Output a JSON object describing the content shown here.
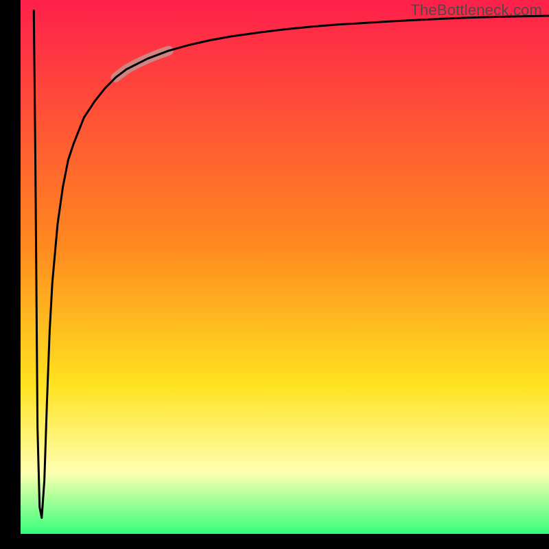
{
  "watermark": "TheBottleneck.com",
  "chart_data": {
    "type": "line",
    "title": "",
    "xlabel": "",
    "ylabel": "",
    "xlim": [
      0,
      100
    ],
    "ylim": [
      0,
      100
    ],
    "background_gradient": {
      "stops": [
        {
          "offset": 0.0,
          "color": "#ff1f4b"
        },
        {
          "offset": 0.45,
          "color": "#ff8a1f"
        },
        {
          "offset": 0.7,
          "color": "#ffe21f"
        },
        {
          "offset": 0.86,
          "color": "#ffffb0"
        },
        {
          "offset": 0.96,
          "color": "#4cff82"
        },
        {
          "offset": 1.0,
          "color": "#00e46b"
        }
      ]
    },
    "axis_band_color": "#000000",
    "axis_band_thickness_px_left": 30,
    "axis_band_thickness_px_bottom": 22,
    "series": [
      {
        "name": "bottleneck-curve",
        "color": "#000000",
        "stroke_width": 3,
        "x": [
          2.5,
          2.8,
          3.0,
          3.2,
          3.6,
          4.0,
          4.5,
          5.0,
          5.5,
          6.0,
          7.0,
          8.0,
          9.0,
          10,
          12,
          14,
          16,
          18,
          20,
          24,
          28,
          32,
          36,
          40,
          45,
          50,
          55,
          60,
          65,
          70,
          75,
          80,
          85,
          90,
          95,
          100
        ],
        "y": [
          98,
          70,
          45,
          20,
          5,
          3,
          10,
          25,
          38,
          47,
          58,
          65,
          70,
          73,
          78,
          81,
          83.5,
          85.5,
          87,
          89,
          90.5,
          91.6,
          92.5,
          93.2,
          93.9,
          94.5,
          95.0,
          95.4,
          95.7,
          96.0,
          96.25,
          96.5,
          96.7,
          96.85,
          96.95,
          97.05
        ]
      },
      {
        "name": "highlight-segment",
        "color": "#c98a86",
        "stroke_width": 14,
        "linecap": "round",
        "opacity": 0.95,
        "x": [
          18,
          20,
          22,
          24,
          26,
          28
        ],
        "y": [
          85.5,
          87,
          88.1,
          89,
          89.8,
          90.5
        ]
      }
    ]
  }
}
